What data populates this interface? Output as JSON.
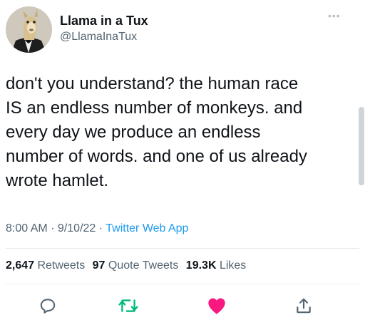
{
  "author": {
    "name": "Llama in a Tux",
    "handle": "@LlamaInaTux"
  },
  "tweet": {
    "text": "don't you understand? the human race\nIS an endless number of monkeys. and\nevery day we produce an endless\nnumber of words. and one of us already\nwrote hamlet."
  },
  "meta": {
    "time": "8:00 AM",
    "separator": " · ",
    "date": "9/10/22",
    "source": "Twitter Web App"
  },
  "stats": {
    "retweets_count": "2,647",
    "retweets_label": "Retweets",
    "quotes_count": "97",
    "quotes_label": "Quote Tweets",
    "likes_count": "19.3K",
    "likes_label": "Likes"
  },
  "icons": {
    "more": "more-dots-icon",
    "reply": "reply-icon",
    "retweet": "retweet-icon",
    "like": "heart-icon",
    "share": "share-icon"
  },
  "colors": {
    "link": "#1d9bf0",
    "like": "#f91880",
    "retweet": "#00ba7c",
    "muted": "#536471",
    "text": "#0f1419"
  }
}
